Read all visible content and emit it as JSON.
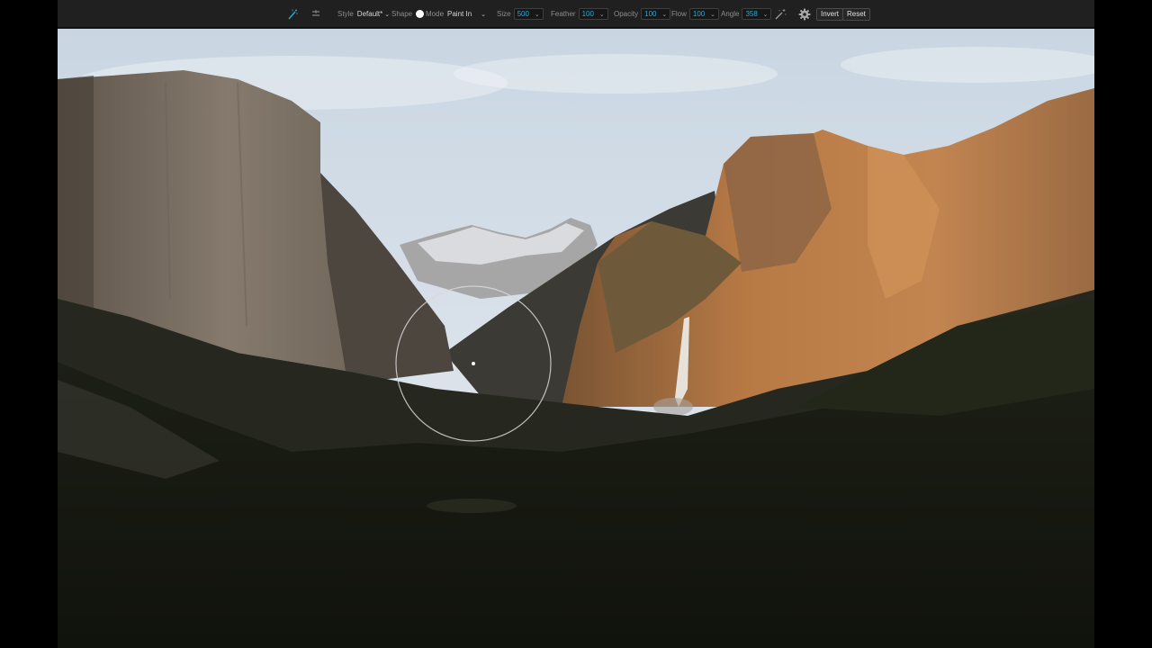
{
  "toolbar": {
    "style_label": "Style",
    "style_value": "Default*",
    "shape_label": "Shape",
    "mode_label": "Mode",
    "mode_value": "Paint In",
    "size_label": "Size",
    "size_value": "500",
    "feather_label": "Feather",
    "feather_value": "100",
    "opacity_label": "Opacity",
    "opacity_value": "100",
    "flow_label": "Flow",
    "flow_value": "100",
    "angle_label": "Angle",
    "angle_value": "358",
    "invert_label": "Invert",
    "reset_label": "Reset",
    "accent_color": "#2aa8d8"
  },
  "canvas": {
    "image_subject": "mountain-valley-photo",
    "cursor": "brush-cursor-icon"
  }
}
